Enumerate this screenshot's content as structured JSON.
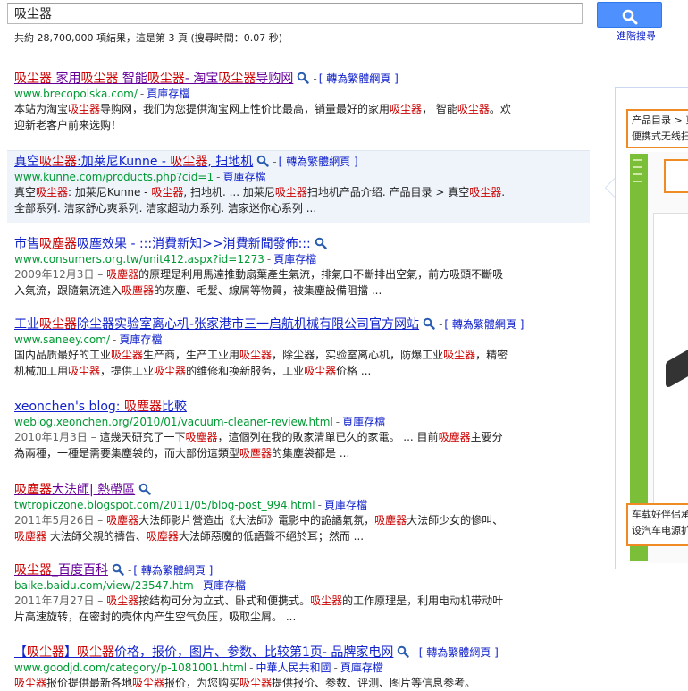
{
  "search": {
    "query": "吸尘器"
  },
  "header": {
    "advanced_search": "進階搜尋"
  },
  "stats": "共約 28,700,000 項結果，這是第 3 頁 (搜尋時間：0.07 秒)",
  "labels": {
    "cache": "頁庫存檔",
    "translate": "轉為繁體網頁"
  },
  "colors": {
    "link": "#1122cc",
    "visited": "#660099",
    "url": "#009933",
    "highlight": "#cc0000",
    "button": "#4d90fe"
  },
  "results": [
    {
      "title_parts": [
        {
          "t": "吸尘器",
          "em": true
        },
        {
          "t": " 家用"
        },
        {
          "t": "吸尘器",
          "em": true
        },
        {
          "t": " 智能"
        },
        {
          "t": "吸尘器",
          "em": true
        },
        {
          "t": "- 淘宝"
        },
        {
          "t": "吸尘器",
          "em": true
        },
        {
          "t": "导购网"
        }
      ],
      "url": "www.brecopolska.com/",
      "translate": true,
      "snippet_parts": [
        {
          "t": "本站为淘宝"
        },
        {
          "t": "吸尘器",
          "em": true
        },
        {
          "t": "导购网，我们为您提供淘宝网上性价比最高，销量最好的家用"
        },
        {
          "t": "吸尘器",
          "em": true
        },
        {
          "t": "， 智能"
        },
        {
          "t": "吸尘器",
          "em": true
        },
        {
          "t": "。欢迎新老客户前来选购！"
        }
      ]
    },
    {
      "title_parts": [
        {
          "t": "真空"
        },
        {
          "t": "吸尘器",
          "em": true
        },
        {
          "t": ":加莱尼Kunne - "
        },
        {
          "t": "吸尘器",
          "em": true
        },
        {
          "t": ", 扫地机"
        }
      ],
      "url": "www.kunne.com/products.php?cid=1",
      "translate": true,
      "snippet_parts": [
        {
          "t": "真空"
        },
        {
          "t": "吸尘器",
          "em": true
        },
        {
          "t": ": 加莱尼Kunne - "
        },
        {
          "t": "吸尘器",
          "em": true
        },
        {
          "t": ", 扫地机. ... 加莱尼"
        },
        {
          "t": "吸尘器",
          "em": true
        },
        {
          "t": "扫地机产品介绍. 产品目录 > 真空"
        },
        {
          "t": "吸尘器",
          "em": true
        },
        {
          "t": ". 全部系列. 洁家舒心爽系列. 洁家超动力系列. 洁家迷你心系列 ..."
        }
      ]
    },
    {
      "title_parts": [
        {
          "t": "市售"
        },
        {
          "t": "吸塵器",
          "em": true
        },
        {
          "t": "吸塵效果 - :::消費新知>>消費新聞發佈:::"
        }
      ],
      "url": "www.consumers.org.tw/unit412.aspx?id=1273",
      "translate": false,
      "date": "2009年12月3日",
      "snippet_parts": [
        {
          "t": "吸塵器",
          "em": true
        },
        {
          "t": "的原理是利用馬達推動扇葉產生氣流，排氣口不斷排出空氣，前方吸頭不斷吸入氣流，跟隨氣流進入"
        },
        {
          "t": "吸塵器",
          "em": true
        },
        {
          "t": "的灰塵、毛髮、線屑等物質，被集塵設備阻擋 ..."
        }
      ]
    },
    {
      "title_parts": [
        {
          "t": "工业"
        },
        {
          "t": "吸尘器",
          "em": true
        },
        {
          "t": "除尘器实验室离心机-张家港市三一启航机械有限公司官方网站"
        }
      ],
      "url": "www.saneey.com/",
      "translate": true,
      "snippet_parts": [
        {
          "t": "国内品质最好的工业"
        },
        {
          "t": "吸尘器",
          "em": true
        },
        {
          "t": "生产商，生产工业用"
        },
        {
          "t": "吸尘器",
          "em": true
        },
        {
          "t": "，除尘器，实验室离心机，防爆工业"
        },
        {
          "t": "吸尘器",
          "em": true
        },
        {
          "t": "，精密机械加工用"
        },
        {
          "t": "吸尘器",
          "em": true
        },
        {
          "t": "，提供工业"
        },
        {
          "t": "吸尘器",
          "em": true
        },
        {
          "t": "的维修和换新服务，工业"
        },
        {
          "t": "吸尘器",
          "em": true
        },
        {
          "t": "价格 ..."
        }
      ]
    },
    {
      "title_parts": [
        {
          "t": "xeonchen's blog: "
        },
        {
          "t": "吸塵器",
          "em": true
        },
        {
          "t": "比較"
        }
      ],
      "url": "weblog.xeonchen.org/2010/01/vacuum-cleaner-review.html",
      "translate": false,
      "date": "2010年1月3日",
      "snippet_parts": [
        {
          "t": "這幾天研究了一下"
        },
        {
          "t": "吸塵器",
          "em": true
        },
        {
          "t": "，這個列在我的敗家清單已久的家電。 ... 目前"
        },
        {
          "t": "吸塵器",
          "em": true
        },
        {
          "t": "主要分為兩種，一種是需要集塵袋的，而大部份這類型"
        },
        {
          "t": "吸塵器",
          "em": true
        },
        {
          "t": "的集塵袋都是 ..."
        }
      ]
    },
    {
      "title_parts": [
        {
          "t": "吸塵器",
          "em": true
        },
        {
          "t": "大法師| 熱帶區"
        }
      ],
      "url": "twtropiczone.blogspot.com/2011/05/blog-post_994.html",
      "translate": false,
      "date": "2011年5月26日",
      "snippet_parts": [
        {
          "t": "吸塵器",
          "em": true
        },
        {
          "t": "大法師影片營造出《大法師》電影中的詭譎氣氛，"
        },
        {
          "t": "吸塵器",
          "em": true
        },
        {
          "t": "大法師少女的慘叫、"
        },
        {
          "t": "吸塵器",
          "em": true
        },
        {
          "t": " 大法師父親的禱告、"
        },
        {
          "t": "吸塵器",
          "em": true
        },
        {
          "t": "大法師惡魔的低語聲不絕於耳；然而 ..."
        }
      ]
    },
    {
      "title_parts": [
        {
          "t": "吸尘器",
          "em": true
        },
        {
          "t": "_百度百科"
        }
      ],
      "url": "baike.baidu.com/view/23547.htm",
      "translate": true,
      "date": "2011年7月27日",
      "snippet_parts": [
        {
          "t": "吸尘器",
          "em": true
        },
        {
          "t": "按结构可分为立式、卧式和便携式。"
        },
        {
          "t": "吸尘器",
          "em": true
        },
        {
          "t": "的工作原理是，利用电动机带动叶片高速旋转，在密封的壳体内产生空气负压，吸取尘屑。 ..."
        }
      ]
    },
    {
      "title_parts": [
        {
          "t": "【"
        },
        {
          "t": "吸尘器",
          "em": true
        },
        {
          "t": "】"
        },
        {
          "t": "吸尘器",
          "em": true
        },
        {
          "t": "价格，报价，图片、参数、比较第1页- 品牌家电网"
        }
      ],
      "url": "www.goodjd.com/category/p-1081001.html",
      "extra_link": "中華人民共和國",
      "translate": true,
      "snippet_parts": [
        {
          "t": "吸尘器",
          "em": true
        },
        {
          "t": "报价提供最新各地"
        },
        {
          "t": "吸尘器",
          "em": true
        },
        {
          "t": "报价，为您购买"
        },
        {
          "t": "吸尘器",
          "em": true
        },
        {
          "t": "提供报价、参数、评测、图片等信息参考。"
        }
      ]
    }
  ],
  "preview": {
    "top_lines": [
      "产品目录 > 真空吸尘器",
      "便携式无线扫地机"
    ],
    "bottom_lines": [
      "车载好伴侣承",
      "设汽车电源扩"
    ]
  }
}
